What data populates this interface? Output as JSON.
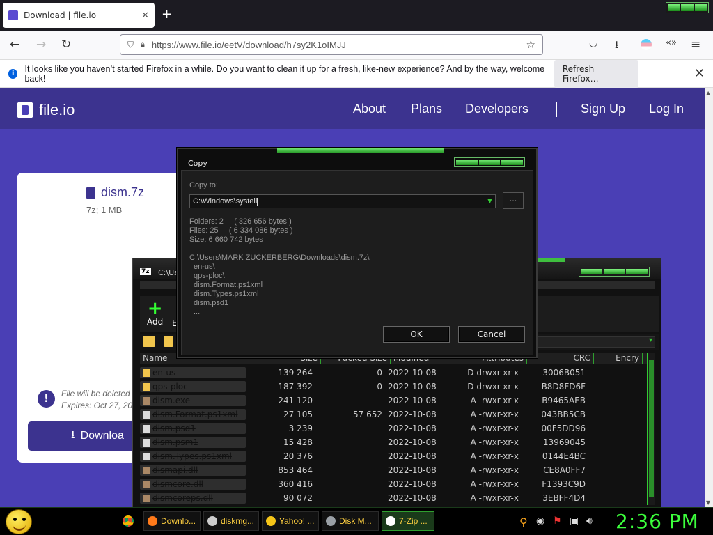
{
  "browser": {
    "tab_title": "Download | file.io",
    "tab_close": "✕",
    "new_tab": "+",
    "url": "https://www.file.io/eetV/download/h7sy2K1oIMJJ",
    "notification": {
      "message": "It looks like you haven’t started Firefox in a while. Do you want to clean it up for a fresh, like-new experience? And by the way, welcome back!",
      "button": "Refresh Firefox…",
      "close": "✕"
    }
  },
  "site": {
    "logo": "file.io",
    "nav": [
      "About",
      "Plans",
      "Developers",
      "Sign Up",
      "Log In"
    ],
    "file_name": "dism.7z",
    "file_meta": "7z; 1 MB",
    "expire_line1": "File will be deleted",
    "expire_line2": "Expires: Oct 27, 20",
    "download_label": "Downloa"
  },
  "zip_window": {
    "title": "C:\\Us",
    "add_label": "Add",
    "add_next": "E",
    "columns": [
      "Name",
      "Size",
      "Packed Size",
      "Modified",
      "Attributes",
      "CRC",
      "Encry"
    ],
    "rows": [
      {
        "name": "en-us",
        "size": "139 264",
        "packed": "0",
        "modified": "2022-10-08",
        "attr": "D drwxr-xr-x",
        "crc": "3006B051",
        "kind": "folder"
      },
      {
        "name": "qps-ploc",
        "size": "187 392",
        "packed": "0",
        "modified": "2022-10-08",
        "attr": "D drwxr-xr-x",
        "crc": "B8D8FD6F",
        "kind": "folder"
      },
      {
        "name": "dism.exe",
        "size": "241 120",
        "packed": "",
        "modified": "2022-10-08",
        "attr": "A -rwxr-xr-x",
        "crc": "B9465AEB",
        "kind": "exe"
      },
      {
        "name": "dism.Format.ps1xml",
        "size": "27 105",
        "packed": "57 652",
        "modified": "2022-10-08",
        "attr": "A -rwxr-xr-x",
        "crc": "043BB5CB",
        "kind": "file"
      },
      {
        "name": "dism.psd1",
        "size": "3 239",
        "packed": "",
        "modified": "2022-10-08",
        "attr": "A -rwxr-xr-x",
        "crc": "00F5DD96",
        "kind": "file"
      },
      {
        "name": "dism.psm1",
        "size": "15 428",
        "packed": "",
        "modified": "2022-10-08",
        "attr": "A -rwxr-xr-x",
        "crc": "13969045",
        "kind": "file"
      },
      {
        "name": "dism.Types.ps1xml",
        "size": "20 376",
        "packed": "",
        "modified": "2022-10-08",
        "attr": "A -rwxr-xr-x",
        "crc": "0144E4BC",
        "kind": "file"
      },
      {
        "name": "dismapi.dll",
        "size": "853 464",
        "packed": "",
        "modified": "2022-10-08",
        "attr": "A -rwxr-xr-x",
        "crc": "CE8A0FF7",
        "kind": "exe"
      },
      {
        "name": "dismcore.dll",
        "size": "360 416",
        "packed": "",
        "modified": "2022-10-08",
        "attr": "A -rwxr-xr-x",
        "crc": "F1393C9D",
        "kind": "exe"
      },
      {
        "name": "dismcoreps.dll",
        "size": "90 072",
        "packed": "",
        "modified": "2022-10-08",
        "attr": "A -rwxr-xr-x",
        "crc": "3EBFF4D4",
        "kind": "exe"
      }
    ]
  },
  "copy_dialog": {
    "title": "Copy",
    "copy_to_label": "Copy to:",
    "path_value": "C:\\Windows\\systell",
    "browse_label": "...",
    "folders_line": "Folders: 2     ( 326 656 bytes )",
    "files_line": "Files: 25     ( 6 334 086 bytes )",
    "size_line": "Size: 6 660 742 bytes",
    "source_path": "C:\\Users\\MARK ZUCKERBERG\\Downloads\\dism.7z\\",
    "items": [
      "en-us\\",
      "qps-ploc\\",
      "dism.Format.ps1xml",
      "dism.Types.ps1xml",
      "dism.psd1",
      "..."
    ],
    "ok_label": "OK",
    "cancel_label": "Cancel"
  },
  "taskbar": {
    "items": [
      {
        "label": "Downlo...",
        "icon": "firefox-icon",
        "color": "#ff7a1a"
      },
      {
        "label": "diskmg...",
        "icon": "disk-icon",
        "color": "#cccccc"
      },
      {
        "label": "Yahoo! ...",
        "icon": "yahoo-icon",
        "color": "#f5c518"
      },
      {
        "label": "Disk M...",
        "icon": "disk-manager-icon",
        "color": "#9aa0a6"
      },
      {
        "label": "7-Zip ...",
        "icon": "7zip-icon",
        "color": "#ffffff"
      }
    ],
    "clock": "2:36 PM"
  }
}
